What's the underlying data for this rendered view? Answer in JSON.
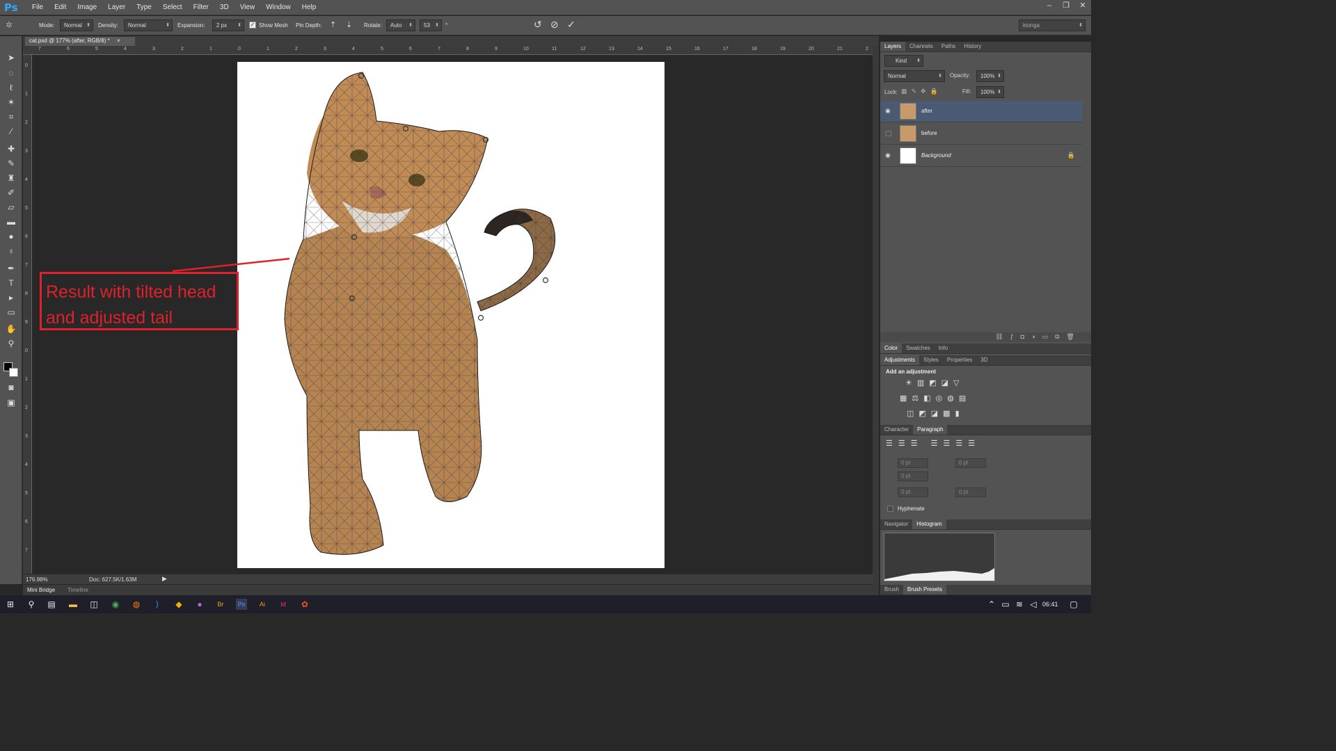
{
  "app": {
    "logo": "Ps",
    "user": "ktonga"
  },
  "menu": [
    "File",
    "Edit",
    "Image",
    "Layer",
    "Type",
    "Select",
    "Filter",
    "3D",
    "View",
    "Window",
    "Help"
  ],
  "window_controls": [
    "–",
    "❐",
    "✕"
  ],
  "options": {
    "mode_label": "Mode:",
    "mode_value": "Normal",
    "density_label": "Density:",
    "density_value": "Normal",
    "expansion_label": "Expansion:",
    "expansion_value": "2 px",
    "show_mesh_label": "Show Mesh",
    "pin_depth_label": "Pin Depth:",
    "rotate_label": "Rotate:",
    "rotate_mode": "Auto",
    "rotate_value": "53",
    "rotate_unit": "°"
  },
  "document": {
    "tab": "cat.psd @ 177% (after, RGB/8) *",
    "tab_close": "×",
    "zoom": "176.98%",
    "doc_info": "Doc: 627.5K/1.63M",
    "ruler_h": [
      "7",
      "6",
      "5",
      "4",
      "3",
      "2",
      "1",
      "0",
      "1",
      "2",
      "3",
      "4",
      "5",
      "6",
      "7",
      "8",
      "9",
      "10",
      "11",
      "12",
      "13",
      "14",
      "15",
      "16",
      "17",
      "18",
      "19",
      "20",
      "21",
      "2"
    ],
    "ruler_v": [
      "0",
      "1",
      "2",
      "3",
      "4",
      "5",
      "6",
      "7",
      "8",
      "9",
      "0",
      "1",
      "2",
      "3",
      "4",
      "5",
      "6",
      "7"
    ]
  },
  "annotation": {
    "line1": "Result with tilted head",
    "line2": "and adjusted tail",
    "color": "#e0202a"
  },
  "bottom_tabs": [
    "Mini Bridge",
    "Timeline"
  ],
  "layers_panel": {
    "tabs": [
      "Layers",
      "Channels",
      "Paths",
      "History"
    ],
    "kind": "Kind",
    "blend_mode": "Normal",
    "opacity_label": "Opacity:",
    "opacity": "100%",
    "lock_label": "Lock:",
    "fill_label": "Fill:",
    "fill": "100%",
    "layers": [
      {
        "name": "after",
        "visible": true,
        "selected": true
      },
      {
        "name": "before",
        "visible": false,
        "selected": false
      },
      {
        "name": "Background",
        "visible": true,
        "selected": false,
        "locked": true
      }
    ]
  },
  "color_panel": {
    "tabs": [
      "Color",
      "Swatches",
      "Info"
    ]
  },
  "adjustments_panel": {
    "tabs": [
      "Adjustments",
      "Styles",
      "Properties",
      "3D"
    ],
    "heading": "Add an adjustment"
  },
  "paragraph_panel": {
    "tabs": [
      "Character",
      "Paragraph"
    ],
    "fields": [
      "0 pt",
      "0 pt",
      "0 pt",
      "0 pt",
      "0 pt"
    ],
    "hyphenate_label": "Hyphenate"
  },
  "navigator_panel": {
    "tabs": [
      "Navigator",
      "Histogram"
    ]
  },
  "brush_panel": {
    "tabs": [
      "Brush",
      "Brush Presets"
    ]
  },
  "taskbar": {
    "time": "06:41"
  },
  "colors": {
    "accent": "#31a8ff",
    "selected_layer": "#4a5a72"
  }
}
